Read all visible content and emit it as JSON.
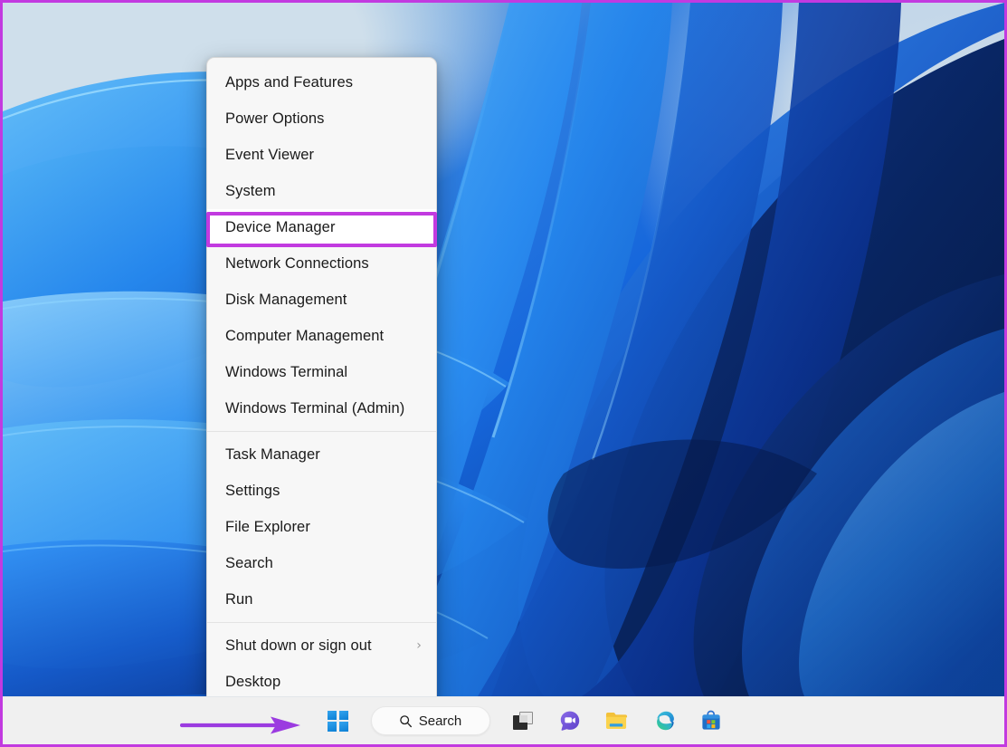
{
  "annotations": {
    "highlight_color": "#c23ae0",
    "border_color": "#c23ae0",
    "arrow_color": "#9b3be0",
    "arrow_target": "start-button",
    "highlight_target": "Device Manager"
  },
  "desktop": {
    "wallpaper_name": "windows-11-bloom-wallpaper",
    "wallpaper_colors": [
      "#c3d6e4",
      "#2f7fe0",
      "#1667dc",
      "#0d3f9e",
      "#071d52"
    ]
  },
  "winx_menu": {
    "name": "Win+X Quick Link menu",
    "groups": [
      {
        "items": [
          {
            "label": "Apps and Features",
            "has_submenu": false,
            "highlighted": false
          },
          {
            "label": "Power Options",
            "has_submenu": false,
            "highlighted": false
          },
          {
            "label": "Event Viewer",
            "has_submenu": false,
            "highlighted": false
          },
          {
            "label": "System",
            "has_submenu": false,
            "highlighted": false
          },
          {
            "label": "Device Manager",
            "has_submenu": false,
            "highlighted": true
          },
          {
            "label": "Network Connections",
            "has_submenu": false,
            "highlighted": false
          },
          {
            "label": "Disk Management",
            "has_submenu": false,
            "highlighted": false
          },
          {
            "label": "Computer Management",
            "has_submenu": false,
            "highlighted": false
          },
          {
            "label": "Windows Terminal",
            "has_submenu": false,
            "highlighted": false
          },
          {
            "label": "Windows Terminal (Admin)",
            "has_submenu": false,
            "highlighted": false
          }
        ]
      },
      {
        "items": [
          {
            "label": "Task Manager",
            "has_submenu": false,
            "highlighted": false
          },
          {
            "label": "Settings",
            "has_submenu": false,
            "highlighted": false
          },
          {
            "label": "File Explorer",
            "has_submenu": false,
            "highlighted": false
          },
          {
            "label": "Search",
            "has_submenu": false,
            "highlighted": false
          },
          {
            "label": "Run",
            "has_submenu": false,
            "highlighted": false
          }
        ]
      },
      {
        "items": [
          {
            "label": "Shut down or sign out",
            "has_submenu": true,
            "submenu_glyph": "›",
            "highlighted": false
          },
          {
            "label": "Desktop",
            "has_submenu": false,
            "highlighted": false
          }
        ]
      }
    ]
  },
  "taskbar": {
    "background": "#f0f0f0",
    "search": {
      "label": "Search",
      "icon": "search-icon"
    },
    "buttons": [
      {
        "name": "start-button",
        "icon": "windows-logo-icon",
        "label": "Start"
      },
      {
        "name": "search-button",
        "icon": "search-icon",
        "label": "Search"
      },
      {
        "name": "task-view-button",
        "icon": "task-view-icon",
        "label": "Task View"
      },
      {
        "name": "chat-button",
        "icon": "chat-icon",
        "label": "Chat"
      },
      {
        "name": "file-explorer-button",
        "icon": "file-explorer-icon",
        "label": "File Explorer"
      },
      {
        "name": "edge-button",
        "icon": "microsoft-edge-icon",
        "label": "Microsoft Edge"
      },
      {
        "name": "store-button",
        "icon": "microsoft-store-icon",
        "label": "Microsoft Store"
      }
    ]
  }
}
